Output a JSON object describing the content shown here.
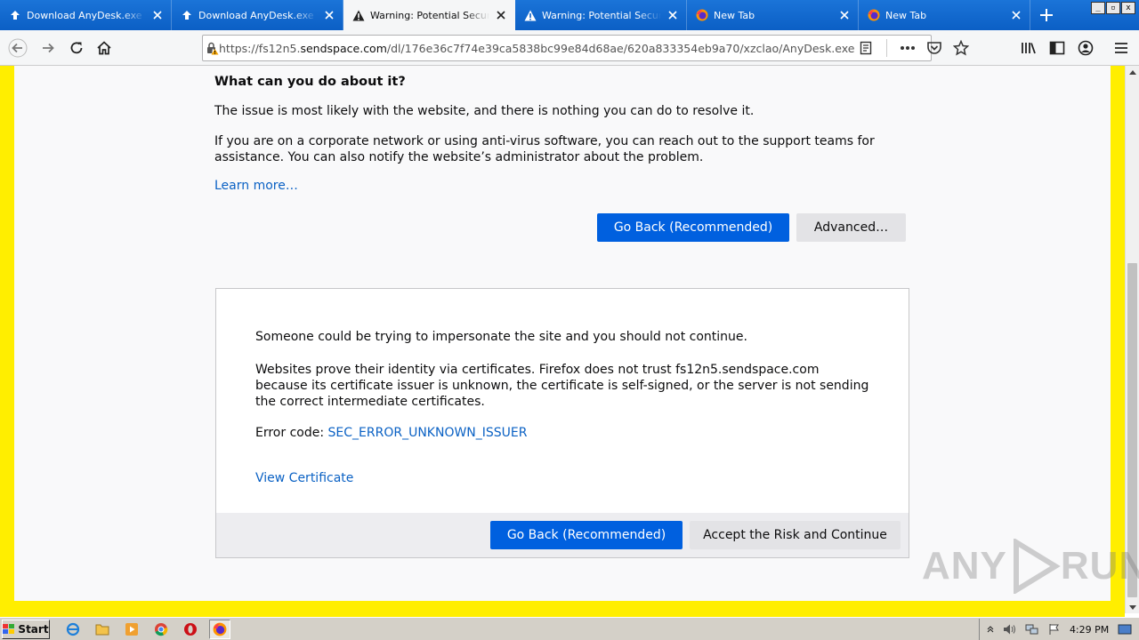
{
  "tabs": [
    {
      "title": "Download AnyDesk.exe from",
      "icon": "upload-arrow-icon",
      "active": false
    },
    {
      "title": "Download AnyDesk.exe from",
      "icon": "upload-arrow-icon",
      "active": false
    },
    {
      "title": "Warning: Potential Security",
      "icon": "warning-icon",
      "active": true
    },
    {
      "title": "Warning: Potential Security",
      "icon": "warning-icon",
      "active": false
    },
    {
      "title": "New Tab",
      "icon": "firefox-icon",
      "active": false
    },
    {
      "title": "New Tab",
      "icon": "firefox-icon",
      "active": false
    }
  ],
  "window_controls": [
    "_",
    "▫",
    "x"
  ],
  "url": {
    "prefix": "https://fs12n5.",
    "host": "sendspace.com",
    "path": "/dl/176e36c7f74e39ca5838bc99e84d68ae/620a833354eb9a70/xzclao/AnyDesk.exe"
  },
  "error_page": {
    "what_heading": "What can you do about it?",
    "p1": "The issue is most likely with the website, and there is nothing you can do to resolve it.",
    "p2": "If you are on a corporate network or using anti-virus software, you can reach out to the support teams for assistance. You can also notify the website’s administrator about the problem.",
    "learn_more": "Learn more…",
    "go_back": "Go Back (Recommended)",
    "advanced": "Advanced…"
  },
  "advanced_panel": {
    "p1": "Someone could be trying to impersonate the site and you should not continue.",
    "p2": "Websites prove their identity via certificates. Firefox does not trust fs12n5.sendspace.com because its certificate issuer is unknown, the certificate is self-signed, or the server is not sending the correct intermediate certificates.",
    "error_label": "Error code: ",
    "error_code": "SEC_ERROR_UNKNOWN_ISSUER",
    "view_certificate": "View Certificate",
    "go_back": "Go Back (Recommended)",
    "accept": "Accept the Risk and Continue"
  },
  "watermark": {
    "left": "ANY",
    "right": "RUN"
  },
  "taskbar": {
    "start": "Start",
    "clock": "4:29 PM"
  },
  "colors": {
    "primary": "#0060df",
    "link": "#0a61c4",
    "tabstrip": "#0b5fc5",
    "border_highlight": "#ffee00"
  }
}
